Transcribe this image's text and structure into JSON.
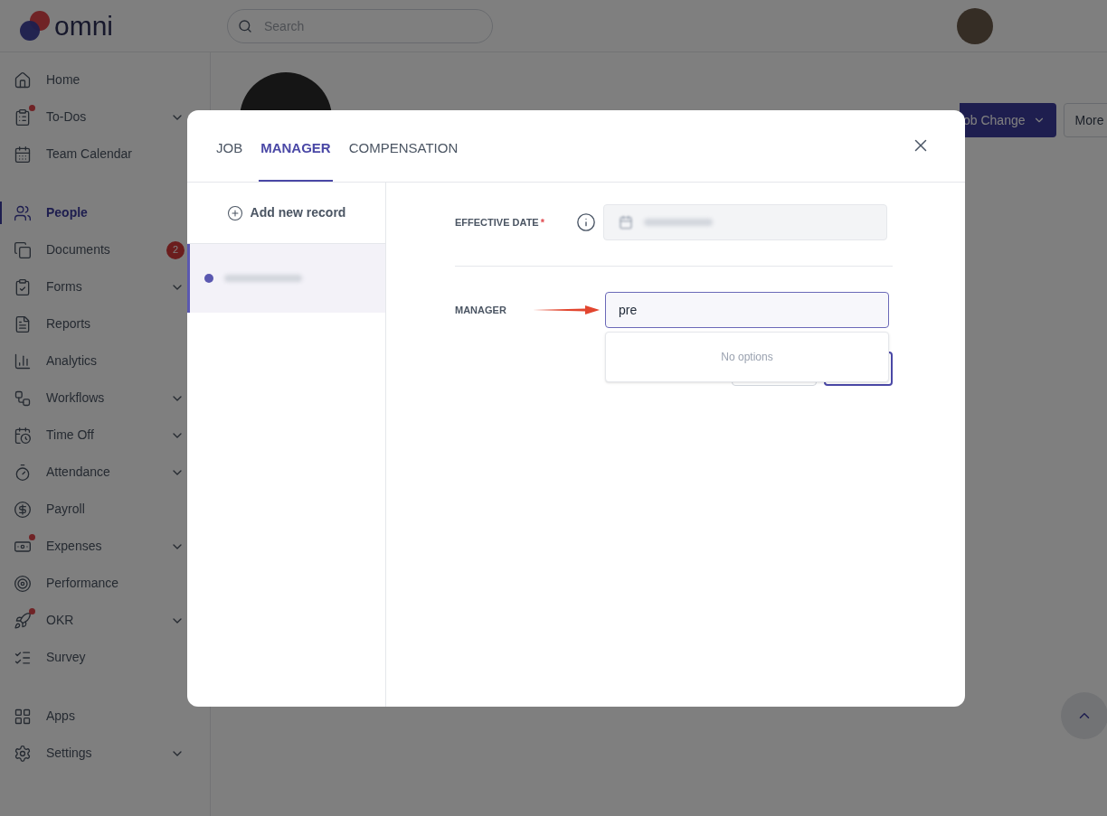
{
  "header": {
    "logo": "omni",
    "search": {
      "placeholder": "Search"
    }
  },
  "sidebar": {
    "sections": [
      {
        "items": [
          {
            "label": "Home",
            "expandable": false,
            "selected": false,
            "dot": false
          },
          {
            "label": "To-Dos",
            "expandable": true,
            "selected": false,
            "dot": true
          },
          {
            "label": "Team Calendar",
            "expandable": false,
            "selected": false,
            "dot": false
          }
        ]
      },
      {
        "items": [
          {
            "label": "People",
            "expandable": false,
            "selected": true,
            "dot": false
          },
          {
            "label": "Documents",
            "selected": false,
            "dot": false,
            "badge": "2"
          },
          {
            "label": "Forms",
            "expandable": true,
            "selected": false,
            "dot": false
          },
          {
            "label": "Reports",
            "expandable": false,
            "selected": false,
            "dot": false
          },
          {
            "label": "Analytics",
            "expandable": false,
            "selected": false,
            "dot": false
          },
          {
            "label": "Workflows",
            "expandable": true,
            "selected": false,
            "dot": false
          },
          {
            "label": "Time Off",
            "expandable": true,
            "selected": false,
            "dot": false
          },
          {
            "label": "Attendance",
            "expandable": true,
            "selected": false,
            "dot": false
          },
          {
            "label": "Payroll",
            "expandable": false,
            "selected": false,
            "dot": false
          },
          {
            "label": "Expenses",
            "expandable": true,
            "selected": false,
            "dot": true
          },
          {
            "label": "Performance",
            "expandable": false,
            "selected": false,
            "dot": false
          },
          {
            "label": "OKR",
            "expandable": true,
            "selected": false,
            "dot": true
          },
          {
            "label": "Survey",
            "expandable": false,
            "selected": false,
            "dot": false
          }
        ]
      },
      {
        "items": [
          {
            "label": "Apps",
            "expandable": false,
            "selected": false,
            "dot": false
          },
          {
            "label": "Settings",
            "expandable": true,
            "selected": false,
            "dot": false
          }
        ]
      }
    ]
  },
  "page": {
    "actions": [
      "ob Change",
      "More"
    ]
  },
  "dialog": {
    "tabs": [
      {
        "label": "JOB",
        "selected": false
      },
      {
        "label": "MANAGER",
        "selected": true
      },
      {
        "label": "COMPENSATION",
        "selected": false
      }
    ],
    "add_record": "Add new record",
    "records": [
      {
        "selected": true
      }
    ],
    "effective_date": {
      "label": "EFFECTIVE DATE",
      "required_mark": "*",
      "disabled": true
    },
    "manager": {
      "label": "MANAGER",
      "value": "pre",
      "empty_text": "No options"
    }
  }
}
